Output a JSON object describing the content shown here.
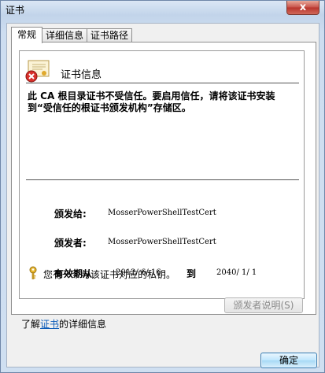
{
  "window": {
    "title": "证书",
    "close_label": "x"
  },
  "tabs": [
    {
      "label": "常规"
    },
    {
      "label": "详细信息"
    },
    {
      "label": "证书路径"
    }
  ],
  "info": {
    "title": "证书信息",
    "warning": "此 CA 根目录证书不受信任。要启用信任，请将该证书安装到“受信任的根证书颁发机构”存储区。"
  },
  "details": {
    "issued_to_label": "颁发给:",
    "issued_to_value": "MosserPowerShellTestCert",
    "issued_by_label": "颁发者:",
    "issued_by_value": "MosserPowerShellTestCert",
    "valid_from_label": "有效期从",
    "valid_from_value": "2012/ 6/ 16",
    "to_label": "到",
    "valid_to_value": "2040/ 1/ 1"
  },
  "private_key_text": "您有一个与该证书对应的私钥。",
  "buttons": {
    "issuer_statement": "颁发者说明(S)",
    "ok": "确定"
  },
  "learn_more": {
    "prefix": "了解",
    "link": "证书",
    "suffix": "的详细信息"
  },
  "icons": {
    "certificate": "certificate-icon",
    "error_badge": "error-badge-icon",
    "key": "key-icon"
  }
}
